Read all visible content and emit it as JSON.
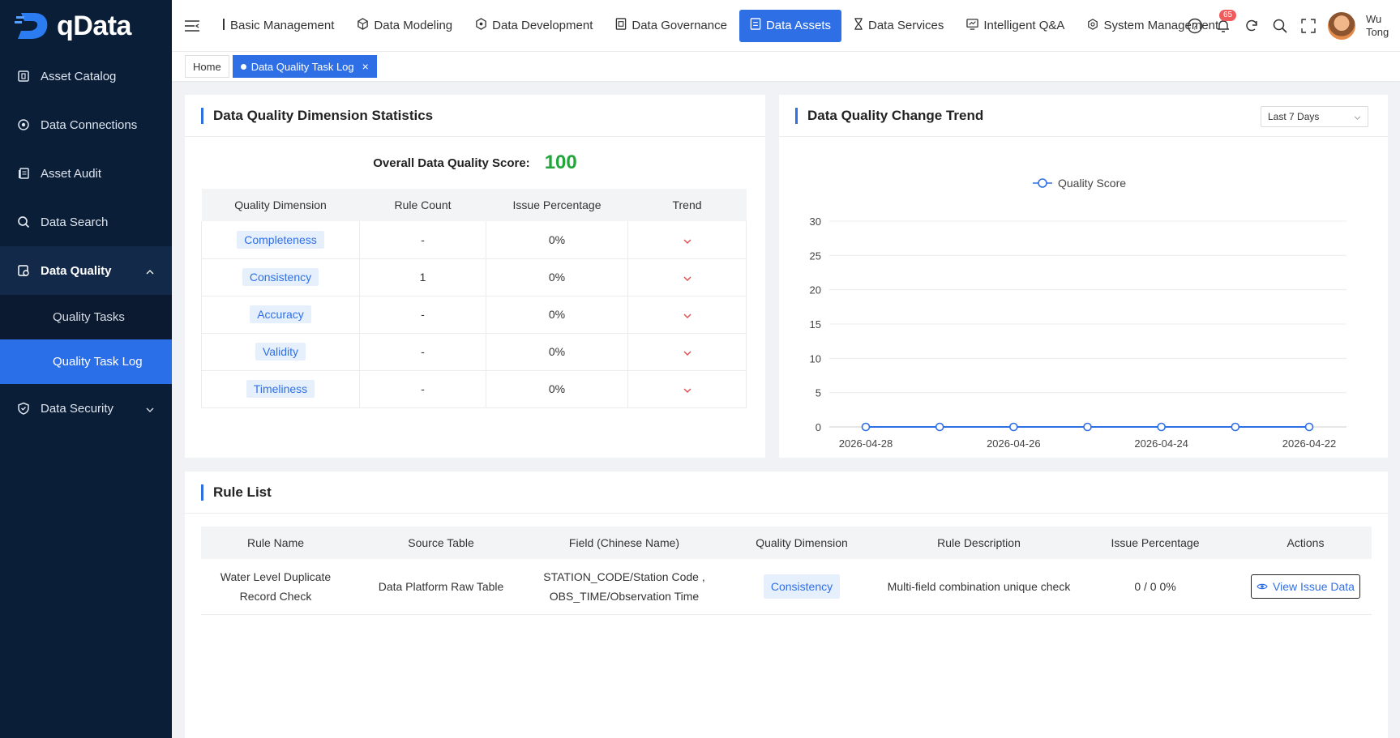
{
  "app": {
    "logo_text": "qData"
  },
  "sidebar": {
    "items": [
      {
        "label": "Asset Catalog",
        "icon": "catalog-icon"
      },
      {
        "label": "Data Connections",
        "icon": "connection-icon"
      },
      {
        "label": "Asset Audit",
        "icon": "audit-icon"
      },
      {
        "label": "Data Search",
        "icon": "search-icon"
      }
    ],
    "open_group": {
      "label": "Data Quality",
      "icon": "quality-icon",
      "children": [
        "Quality Tasks",
        "Quality Task Log"
      ],
      "active_child": "Quality Task Log"
    },
    "bottom": {
      "label": "Data Security",
      "icon": "shield-icon"
    }
  },
  "topnav": {
    "items": [
      {
        "label": "Basic Management",
        "icon": "bar-icon"
      },
      {
        "label": "Data Modeling",
        "icon": "cube-icon"
      },
      {
        "label": "Data Development",
        "icon": "box-icon"
      },
      {
        "label": "Data Governance",
        "icon": "governance-icon"
      },
      {
        "label": "Data Assets",
        "icon": "assets-icon"
      },
      {
        "label": "Data Services",
        "icon": "hourglass-icon"
      },
      {
        "label": "Intelligent Q&A",
        "icon": "chat-icon"
      },
      {
        "label": "System Management",
        "icon": "gear-icon"
      }
    ],
    "active": "Data Assets",
    "notification_count": "65",
    "user": {
      "line1": "Wu",
      "line2": "Tong"
    }
  },
  "tabs": [
    {
      "label": "Home"
    },
    {
      "label": "Data Quality Task Log"
    }
  ],
  "dimension_card": {
    "title": "Data Quality Dimension Statistics",
    "score_label": "Overall Data Quality Score:",
    "score_value": "100",
    "headers": [
      "Quality Dimension",
      "Rule Count",
      "Issue Percentage",
      "Trend"
    ],
    "rows": [
      {
        "dimension": "Completeness",
        "rule_count": "-",
        "issue_pct": "0%",
        "trend": "down"
      },
      {
        "dimension": "Consistency",
        "rule_count": "1",
        "issue_pct": "0%",
        "trend": "down"
      },
      {
        "dimension": "Accuracy",
        "rule_count": "-",
        "issue_pct": "0%",
        "trend": "down"
      },
      {
        "dimension": "Validity",
        "rule_count": "-",
        "issue_pct": "0%",
        "trend": "down"
      },
      {
        "dimension": "Timeliness",
        "rule_count": "-",
        "issue_pct": "0%",
        "trend": "down"
      }
    ]
  },
  "trend_card": {
    "title": "Data Quality Change Trend",
    "range_select": "Last 7 Days"
  },
  "chart_data": {
    "type": "line",
    "legend": [
      "Quality Score"
    ],
    "legend_position": "top-center",
    "x": [
      "2026-04-28",
      "2026-04-27",
      "2026-04-26",
      "2026-04-25",
      "2026-04-24",
      "2026-04-23",
      "2026-04-22"
    ],
    "x_tick_labels": [
      "2026-04-28",
      "2026-04-26",
      "2026-04-24",
      "2026-04-22"
    ],
    "series": [
      {
        "name": "Quality Score",
        "values": [
          0,
          0,
          0,
          0,
          0,
          0,
          0
        ],
        "color": "#2f6fe6"
      }
    ],
    "yticks": [
      0,
      5,
      10,
      15,
      20,
      25,
      30
    ],
    "ylim": [
      0,
      30
    ],
    "grid": true
  },
  "rule_card": {
    "title": "Rule List",
    "headers": [
      "Rule Name",
      "Source Table",
      "Field (Chinese Name)",
      "Quality Dimension",
      "Rule Description",
      "Issue Percentage",
      "Actions"
    ],
    "rows": [
      {
        "rule_name_1": "Water Level Duplicate",
        "rule_name_2": "Record Check",
        "source_table": "Data Platform Raw Table",
        "field_1": "STATION_CODE/Station Code ,",
        "field_2": "OBS_TIME/Observation Time",
        "dimension": "Consistency",
        "description": "Multi-field combination unique check",
        "issue": "0 / 0  0%",
        "action": "View Issue Data"
      }
    ]
  },
  "colors": {
    "primary": "#2f6fe6",
    "sidebar": "#0a1e37",
    "score": "#22a53a",
    "trend_down": "#e24b4b"
  }
}
